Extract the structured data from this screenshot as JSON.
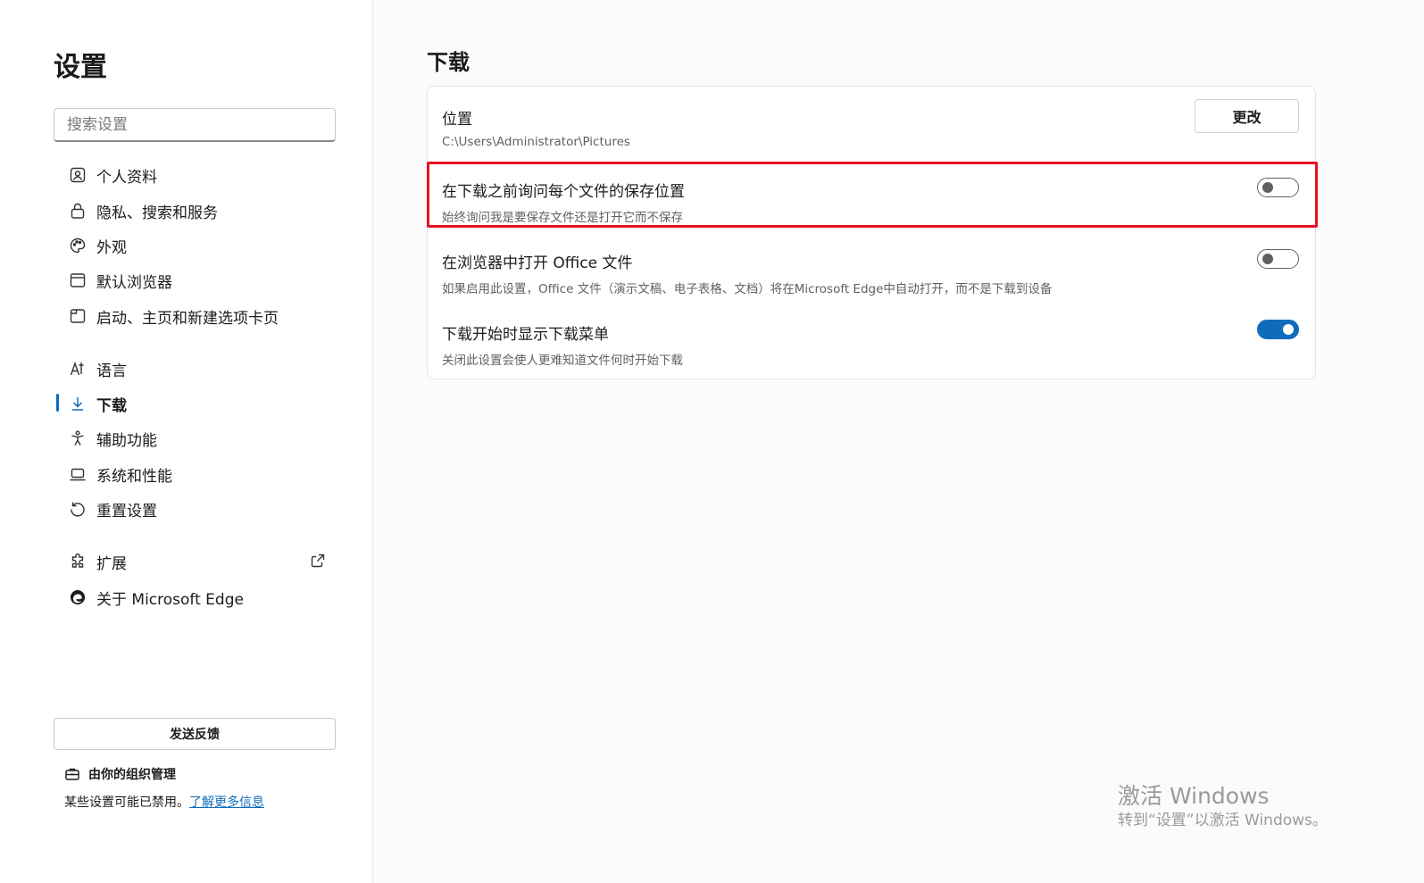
{
  "sidebar": {
    "title": "设置",
    "search_placeholder": "搜索设置",
    "items": [
      {
        "label": "个人资料",
        "icon": "profile-icon"
      },
      {
        "label": "隐私、搜索和服务",
        "icon": "lock-icon"
      },
      {
        "label": "外观",
        "icon": "palette-icon"
      },
      {
        "label": "默认浏览器",
        "icon": "browser-icon"
      },
      {
        "label": "启动、主页和新建选项卡页",
        "icon": "home-tab-icon"
      },
      {
        "label": "语言",
        "icon": "language-icon"
      },
      {
        "label": "下载",
        "icon": "download-icon",
        "active": true
      },
      {
        "label": "辅助功能",
        "icon": "accessibility-icon"
      },
      {
        "label": "系统和性能",
        "icon": "laptop-icon"
      },
      {
        "label": "重置设置",
        "icon": "reset-icon"
      },
      {
        "label": "扩展",
        "icon": "extensions-icon",
        "external": true
      },
      {
        "label": "关于 Microsoft Edge",
        "icon": "edge-logo-icon"
      }
    ],
    "feedback_label": "发送反馈",
    "org_managed": "由你的组织管理",
    "org_note": "某些设置可能已禁用。",
    "org_link": "了解更多信息"
  },
  "main": {
    "title": "下载",
    "location": {
      "title": "位置",
      "path": "C:\\Users\\Administrator\\Pictures",
      "button": "更改"
    },
    "settings": [
      {
        "title": "在下载之前询问每个文件的保存位置",
        "desc": "始终询问我是要保存文件还是打开它而不保存",
        "on": false
      },
      {
        "title": "在浏览器中打开 Office 文件",
        "desc": "如果启用此设置，Office 文件（演示文稿、电子表格、文档）将在Microsoft Edge中自动打开，而不是下载到设备",
        "on": false
      },
      {
        "title": "下载开始时显示下载菜单",
        "desc": "关闭此设置会使人更难知道文件何时开始下载",
        "on": true
      }
    ]
  },
  "watermark": {
    "line1": "激活 Windows",
    "line2": "转到“设置”以激活 Windows。"
  },
  "colors": {
    "accent": "#0f6cbd",
    "highlight": "#e81123"
  }
}
